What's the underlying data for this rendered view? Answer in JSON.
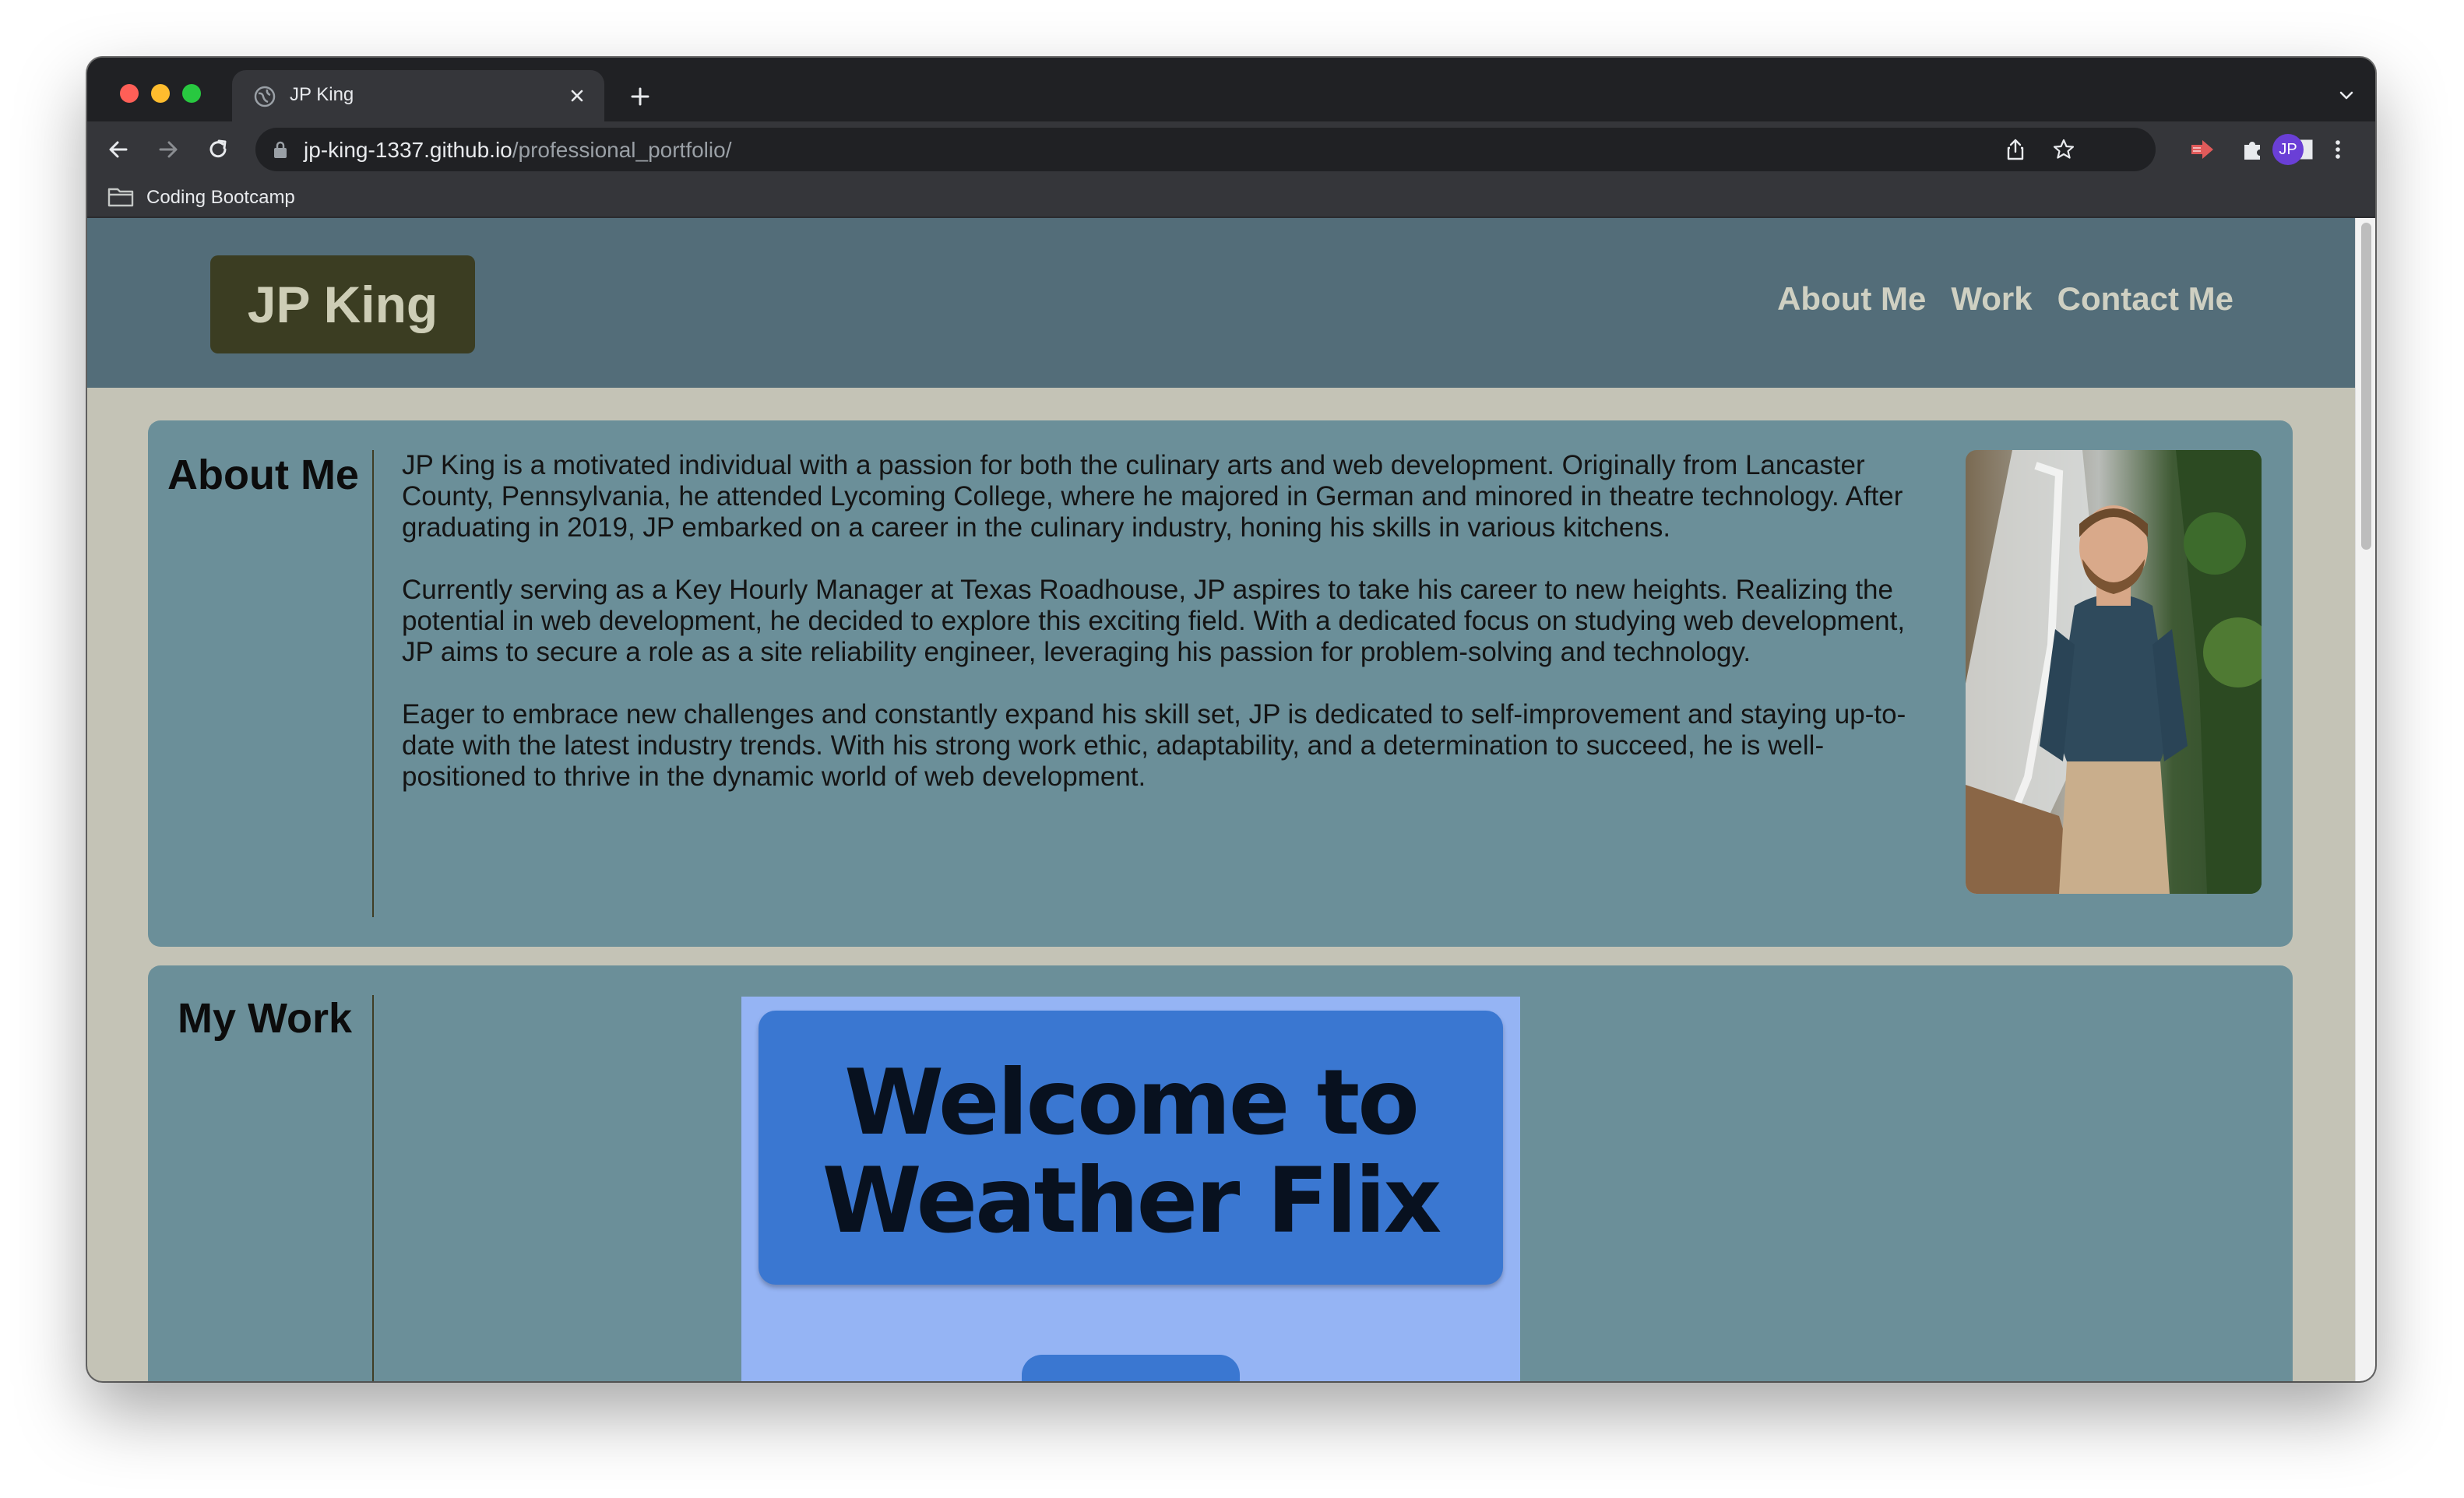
{
  "browser": {
    "tab_title": "JP King",
    "url_host": "jp-king-1337.github.io",
    "url_path": "/professional_portfolio/",
    "profile_initials": "JP",
    "bookmarks": [
      {
        "label": "Coding Bootcamp",
        "icon": "folder-icon"
      }
    ],
    "toolbar_icons": [
      "back-icon",
      "forward-icon",
      "reload-icon",
      "lock-icon",
      "share-icon",
      "star-icon",
      "extension-arrow-icon",
      "puzzle-icon",
      "sidepanel-icon",
      "menu-icon"
    ]
  },
  "site": {
    "logo": "JP King",
    "nav": [
      {
        "label": "About Me"
      },
      {
        "label": "Work"
      },
      {
        "label": "Contact Me"
      }
    ],
    "about": {
      "title": "About Me",
      "paragraphs": [
        "JP King is a motivated individual with a passion for both the culinary arts and web development. Originally from Lancaster County, Pennsylvania, he attended Lycoming College, where he majored in German and minored in theatre technology. After graduating in 2019, JP embarked on a career in the culinary industry, honing his skills in various kitchens.",
        "Currently serving as a Key Hourly Manager at Texas Roadhouse, JP aspires to take his career to new heights. Realizing the potential in web development, he decided to explore this exciting field. With a dedicated focus on studying web development, JP aims to secure a role as a site reliability engineer, leveraging his passion for problem-solving and technology.",
        "Eager to embrace new challenges and constantly expand his skill set, JP is dedicated to self-improvement and staying up-to-date with the latest industry trends. With his strong work ethic, adaptability, and a determination to succeed, he is well-positioned to thrive in the dynamic world of web development."
      ]
    },
    "work": {
      "title": "My Work",
      "projects": [
        {
          "title": "Welcome to Weather Flix"
        }
      ]
    }
  },
  "colors": {
    "header_bg": "#536d79",
    "logo_bg": "#3b3d22",
    "section_bg": "#6b8f99",
    "page_bg": "#c4c3b6",
    "project_bg": "#95b4f4",
    "project_card": "#3a77d1"
  }
}
